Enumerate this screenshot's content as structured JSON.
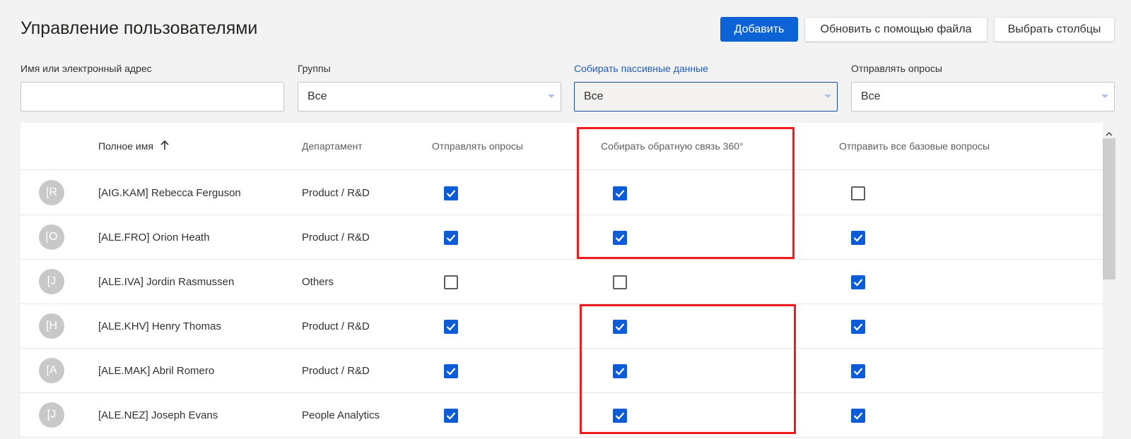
{
  "page": {
    "title": "Управление пользователями"
  },
  "toolbar": {
    "add_label": "Добавить",
    "update_file_label": "Обновить с помощью файла",
    "choose_columns_label": "Выбрать столбцы"
  },
  "filters": {
    "name": {
      "label": "Имя или электронный адрес",
      "value": ""
    },
    "groups": {
      "label": "Группы",
      "value": "Все"
    },
    "passive": {
      "label": "Собирать пассивные данные",
      "value": "Все"
    },
    "surveys": {
      "label": "Отправлять опросы",
      "value": "Все"
    }
  },
  "table": {
    "columns": {
      "name": "Полное имя",
      "department": "Департамент",
      "send_surveys": "Отправлять опросы",
      "feedback_360": "Собирать обратную связь 360°",
      "base_questions": "Отправить все базовые вопросы"
    },
    "sort": {
      "column": "name",
      "direction": "asc"
    },
    "rows": [
      {
        "initial": "[R",
        "name": "[AIG.KAM] Rebecca Ferguson",
        "department": "Product / R&D",
        "send_surveys": true,
        "feedback_360": true,
        "base_questions": false
      },
      {
        "initial": "[O",
        "name": "[ALE.FRO] Orion Heath",
        "department": "Product / R&D",
        "send_surveys": true,
        "feedback_360": true,
        "base_questions": true
      },
      {
        "initial": "[J",
        "name": "[ALE.IVA] Jordin Rasmussen",
        "department": "Others",
        "send_surveys": false,
        "feedback_360": false,
        "base_questions": true
      },
      {
        "initial": "[H",
        "name": "[ALE.KHV] Henry Thomas",
        "department": "Product / R&D",
        "send_surveys": true,
        "feedback_360": true,
        "base_questions": true
      },
      {
        "initial": "[A",
        "name": "[ALE.MAK] Abril Romero",
        "department": "Product / R&D",
        "send_surveys": true,
        "feedback_360": true,
        "base_questions": true
      },
      {
        "initial": "[J",
        "name": "[ALE.NEZ] Joseph Evans",
        "department": "People Analytics",
        "send_surveys": true,
        "feedback_360": true,
        "base_questions": true
      }
    ]
  },
  "colors": {
    "primary": "#0b63d6",
    "checkbox_on": "#0b5cd6",
    "highlight": "#ee1c1c",
    "active_label": "#1f5ab5"
  },
  "icons": {
    "sort": "arrow-up-icon",
    "dropdown": "chevron-down-icon",
    "checkbox": "check-icon",
    "scroll": "scroll-up-icon"
  }
}
